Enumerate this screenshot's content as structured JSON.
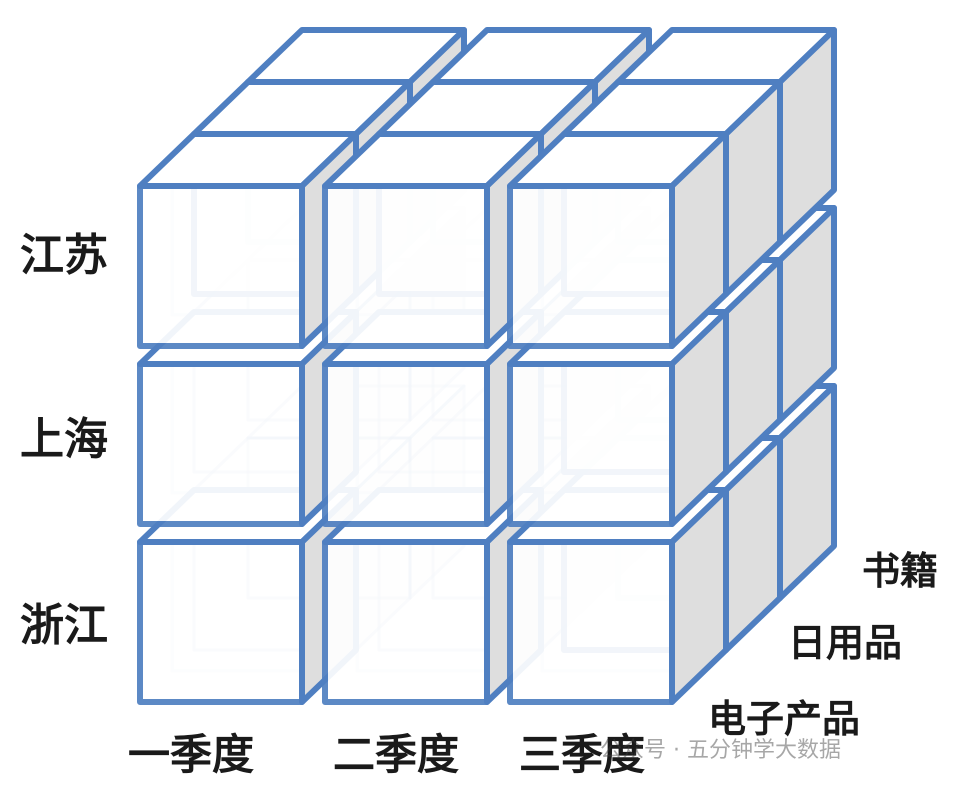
{
  "cube": {
    "rows": [
      "江苏",
      "上海",
      "浙江"
    ],
    "columns": [
      "一季度",
      "二季度",
      "三季度"
    ],
    "depth": [
      "电子产品",
      "日用品",
      "书籍"
    ]
  },
  "colors": {
    "edge": "#4f7fc1",
    "front": "#ffffff",
    "top": "#ffffff",
    "side": "#dedede",
    "label": "#1a1a1a"
  },
  "watermark": "公众号 · 五分钟学大数据"
}
